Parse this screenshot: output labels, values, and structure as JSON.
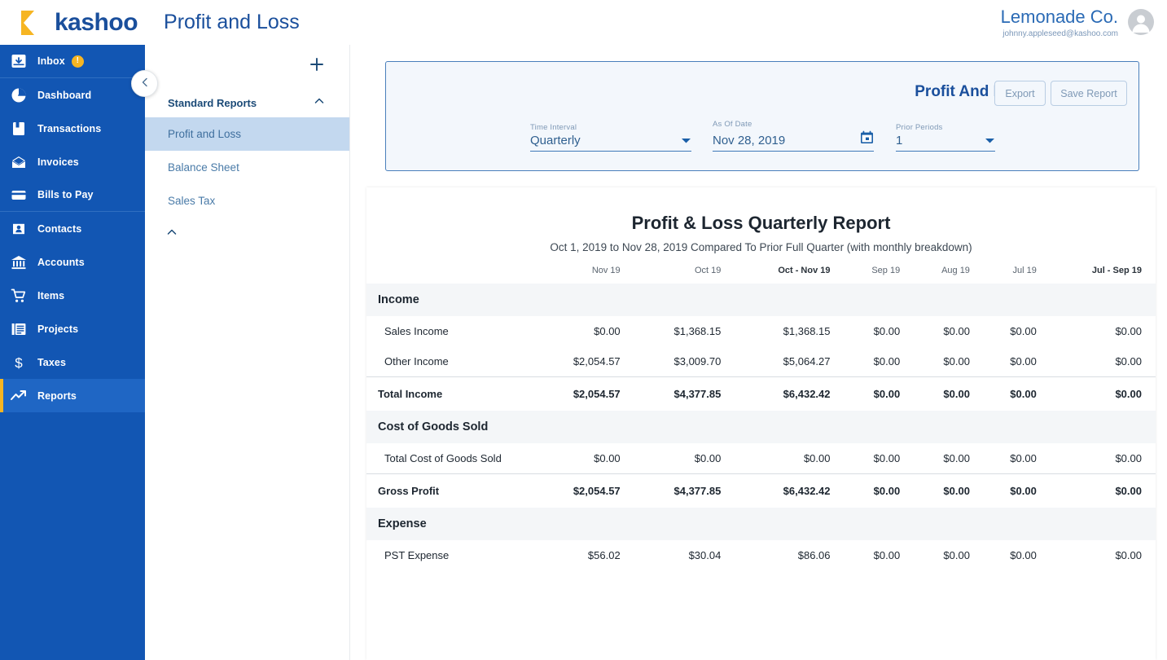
{
  "header": {
    "logo_text": "kashoo",
    "logo_icon": "kashoo-k-mark",
    "page_title": "Profit and Loss",
    "company_name": "Lemonade Co.",
    "company_email": "johnny.appleseed@kashoo.com",
    "avatar_icon": "user-avatar-icon"
  },
  "sidebar": {
    "collapse_icon": "chevron-left-icon",
    "items": [
      {
        "label": "Inbox",
        "icon": "inbox-icon",
        "badge": "!",
        "active": false
      },
      {
        "label": "Dashboard",
        "icon": "dashboard-pie-icon",
        "badge": "",
        "active": false
      },
      {
        "label": "Transactions",
        "icon": "transactions-book-icon",
        "badge": "",
        "active": false
      },
      {
        "label": "Invoices",
        "icon": "invoices-envelope-icon",
        "badge": "",
        "active": false
      },
      {
        "label": "Bills to Pay",
        "icon": "bills-card-icon",
        "badge": "",
        "active": false
      },
      {
        "label": "Contacts",
        "icon": "contacts-person-icon",
        "badge": "",
        "active": false
      },
      {
        "label": "Accounts",
        "icon": "accounts-bank-icon",
        "badge": "",
        "active": false
      },
      {
        "label": "Items",
        "icon": "items-cart-icon",
        "badge": "",
        "active": false
      },
      {
        "label": "Projects",
        "icon": "projects-list-icon",
        "badge": "",
        "active": false
      },
      {
        "label": "Taxes",
        "icon": "taxes-dollar-icon",
        "badge": "",
        "active": false
      },
      {
        "label": "Reports",
        "icon": "reports-trend-icon",
        "badge": "",
        "active": true
      }
    ]
  },
  "subpanel": {
    "add_icon": "plus-icon",
    "group_title": "Standard Reports",
    "group_collapse_icon": "chevron-up-icon",
    "footer_collapse_icon": "chevron-up-icon",
    "items": [
      {
        "label": "Profit and Loss",
        "active": true
      },
      {
        "label": "Balance Sheet",
        "active": false
      },
      {
        "label": "Sales Tax",
        "active": false
      }
    ]
  },
  "filters": {
    "title": "Profit And Loss",
    "export_label": "Export",
    "save_label": "Save Report",
    "time_interval": {
      "label": "Time Interval",
      "value": "Quarterly",
      "icon": "chevron-down-icon"
    },
    "as_of_date": {
      "label": "As Of Date",
      "value": "Nov 28, 2019",
      "icon": "calendar-icon"
    },
    "prior_periods": {
      "label": "Prior Periods",
      "value": "1",
      "icon": "chevron-down-icon"
    }
  },
  "report": {
    "title": "Profit & Loss Quarterly Report",
    "subtitle": "Oct 1, 2019 to Nov 28, 2019 Compared To Prior Full Quarter (with monthly breakdown)",
    "columns": [
      {
        "label": "Nov 19",
        "bold": false
      },
      {
        "label": "Oct 19",
        "bold": false
      },
      {
        "label": "Oct - Nov 19",
        "bold": true
      },
      {
        "label": "Sep 19",
        "bold": false
      },
      {
        "label": "Aug 19",
        "bold": false
      },
      {
        "label": "Jul 19",
        "bold": false
      },
      {
        "label": "Jul - Sep 19",
        "bold": true
      }
    ],
    "rows": [
      {
        "type": "section",
        "label": "Income",
        "values": [
          "",
          "",
          "",
          "",
          "",
          "",
          ""
        ]
      },
      {
        "type": "data",
        "label": "Sales Income",
        "values": [
          "$0.00",
          "$1,368.15",
          "$1,368.15",
          "$0.00",
          "$0.00",
          "$0.00",
          "$0.00"
        ]
      },
      {
        "type": "data",
        "label": "Other Income",
        "values": [
          "$2,054.57",
          "$3,009.70",
          "$5,064.27",
          "$0.00",
          "$0.00",
          "$0.00",
          "$0.00"
        ]
      },
      {
        "type": "total",
        "label": "Total Income",
        "values": [
          "$2,054.57",
          "$4,377.85",
          "$6,432.42",
          "$0.00",
          "$0.00",
          "$0.00",
          "$0.00"
        ]
      },
      {
        "type": "section",
        "label": "Cost of Goods Sold",
        "values": [
          "",
          "",
          "",
          "",
          "",
          "",
          ""
        ]
      },
      {
        "type": "data",
        "label": "Total Cost of Goods Sold",
        "values": [
          "$0.00",
          "$0.00",
          "$0.00",
          "$0.00",
          "$0.00",
          "$0.00",
          "$0.00"
        ]
      },
      {
        "type": "total",
        "label": "Gross Profit",
        "values": [
          "$2,054.57",
          "$4,377.85",
          "$6,432.42",
          "$0.00",
          "$0.00",
          "$0.00",
          "$0.00"
        ]
      },
      {
        "type": "section",
        "label": "Expense",
        "values": [
          "",
          "",
          "",
          "",
          "",
          "",
          ""
        ]
      },
      {
        "type": "data",
        "label": "PST Expense",
        "values": [
          "$56.02",
          "$30.04",
          "$86.06",
          "$0.00",
          "$0.00",
          "$0.00",
          "$0.00"
        ]
      }
    ]
  },
  "colors": {
    "brand_blue": "#1256B3",
    "brand_yellow": "#F6B522",
    "title_blue": "#1a4f9c",
    "nav_active": "#1f66c4",
    "subitem_active": "#c3d8ef"
  }
}
